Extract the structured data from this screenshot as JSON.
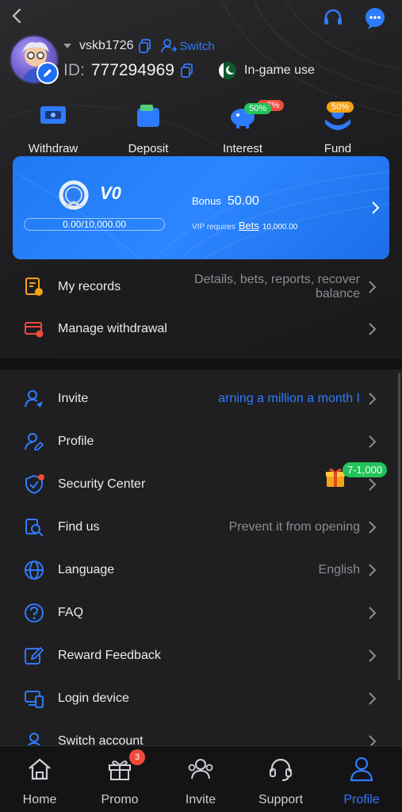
{
  "header": {
    "back_icon": "chevron-left-icon",
    "support_icon": "headset-icon",
    "chat_icon": "chat-bubble-icon"
  },
  "user": {
    "username": "vskb1726",
    "switch_label": "Switch",
    "id_label": "ID:",
    "id_value": "777294969",
    "ingame_label": "In-game use"
  },
  "quick_actions": [
    {
      "label": "Withdraw",
      "icon": "withdraw-icon",
      "badge": ""
    },
    {
      "label": "Deposit",
      "icon": "deposit-icon",
      "badge": "+7%"
    },
    {
      "label": "Interest",
      "icon": "piggy-bank-icon",
      "badge": "50%"
    },
    {
      "label": "Fund",
      "icon": "fund-icon",
      "badge": "50%"
    }
  ],
  "vip": {
    "level": "V0",
    "progress_text": "0.00/10,000.00",
    "bonus_label": "Bonus",
    "bonus_value": "50.00",
    "requires_label": "VIP requires",
    "bets_label": "Bets",
    "bets_value": "10,000.00"
  },
  "records_menu": [
    {
      "label": "My records",
      "value": "Details, bets, reports, recover balance",
      "icon": "records-icon"
    },
    {
      "label": "Manage withdrawal",
      "value": "",
      "icon": "withdrawal-card-icon"
    }
  ],
  "main_menu": [
    {
      "label": "Invite",
      "value": "arning a million a month I",
      "icon": "invite-user-icon"
    },
    {
      "label": "Profile",
      "value": "",
      "icon": "profile-edit-icon"
    },
    {
      "label": "Security Center",
      "value": "",
      "icon": "shield-icon",
      "promo": "7-1,000"
    },
    {
      "label": "Find us",
      "value": "Prevent it from opening",
      "icon": "find-us-icon"
    },
    {
      "label": "Language",
      "value": "English",
      "icon": "globe-icon"
    },
    {
      "label": "FAQ",
      "value": "",
      "icon": "question-icon"
    },
    {
      "label": "Reward Feedback",
      "value": "",
      "icon": "feedback-edit-icon"
    },
    {
      "label": "Login device",
      "value": "",
      "icon": "devices-icon"
    },
    {
      "label": "Switch account",
      "value": "",
      "icon": "switch-account-icon"
    }
  ],
  "bottom_nav": [
    {
      "label": "Home",
      "icon": "home-icon"
    },
    {
      "label": "Promo",
      "icon": "gift-box-icon",
      "badge": "3"
    },
    {
      "label": "Invite",
      "icon": "invite-group-icon"
    },
    {
      "label": "Support",
      "icon": "headset-icon"
    },
    {
      "label": "Profile",
      "icon": "profile-icon",
      "active": true
    }
  ],
  "colors": {
    "accent": "#2f7bff",
    "background": "#1f1f21",
    "vip_card": "#1f79f2",
    "badge_red": "#f04b3b",
    "badge_green": "#22c35a"
  }
}
